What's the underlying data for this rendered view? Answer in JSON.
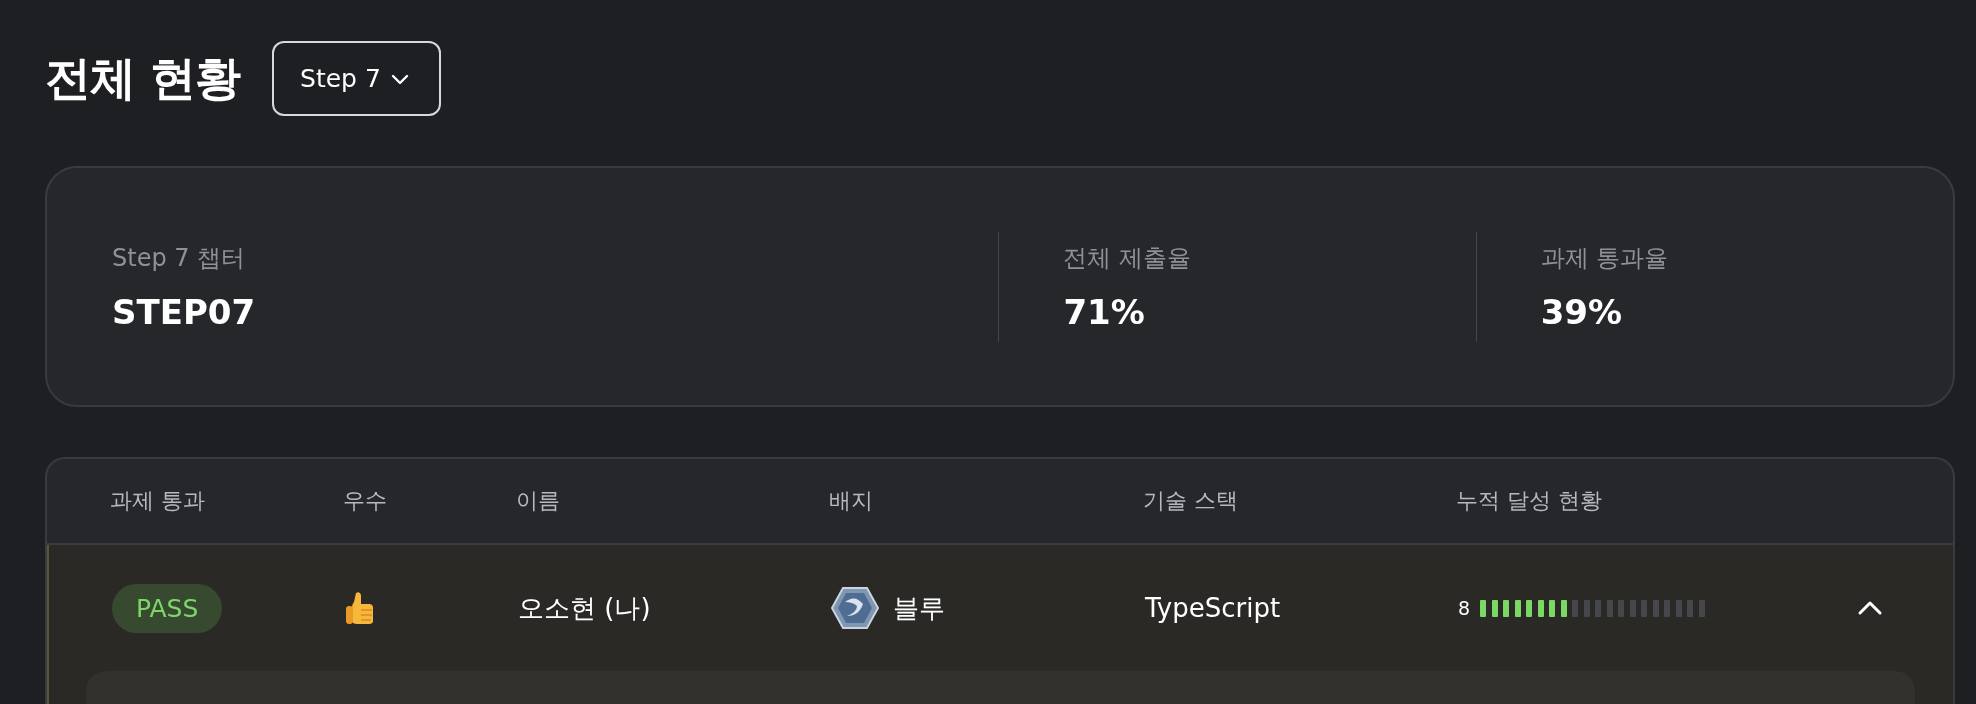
{
  "page_title": "전체 현황",
  "step_select": {
    "value": "Step 7"
  },
  "summary": [
    {
      "label": "Step 7 챕터",
      "value": "STEP07"
    },
    {
      "label": "전체 제출율",
      "value": "71%"
    },
    {
      "label": "과제 통과율",
      "value": "39%"
    }
  ],
  "table": {
    "columns": [
      "과제 통과",
      "우수",
      "이름",
      "배지",
      "기술 스택",
      "누적 달성 현황"
    ],
    "rows": [
      {
        "status": "PASS",
        "excellent": true,
        "name": "오소현 (나)",
        "badge": "블루",
        "stack": "TypeScript",
        "progress_count": "8",
        "level": 0.4,
        "expanded": true
      }
    ]
  }
}
